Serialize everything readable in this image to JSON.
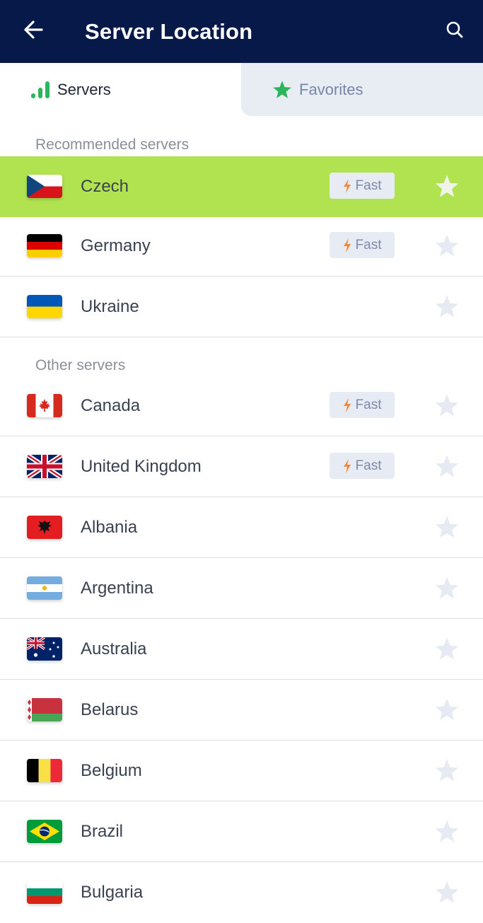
{
  "header": {
    "title": "Server Location",
    "background": "#061949",
    "back_icon": "arrow-left-icon",
    "search_icon": "search-icon"
  },
  "tabs": [
    {
      "label": "Servers",
      "icon": "signal-bars-icon",
      "active": true
    },
    {
      "label": "Favorites",
      "icon": "star-icon",
      "active": false
    }
  ],
  "colors": {
    "selected_row": "#b1e250",
    "signal_green": "#2bb65c",
    "favorites_star": "#2bb65c",
    "fast_bolt": "#f08a3c"
  },
  "sections": [
    {
      "title": "Recommended servers",
      "servers": [
        {
          "country": "Czech",
          "flag": "cz",
          "fast": true,
          "selected": true
        },
        {
          "country": "Germany",
          "flag": "de",
          "fast": true,
          "selected": false
        },
        {
          "country": "Ukraine",
          "flag": "ua",
          "fast": false,
          "selected": false
        }
      ]
    },
    {
      "title": "Other servers",
      "servers": [
        {
          "country": "Canada",
          "flag": "ca",
          "fast": true
        },
        {
          "country": "United Kingdom",
          "flag": "gb",
          "fast": true
        },
        {
          "country": "Albania",
          "flag": "al",
          "fast": false
        },
        {
          "country": "Argentina",
          "flag": "ar",
          "fast": false
        },
        {
          "country": "Australia",
          "flag": "au",
          "fast": false
        },
        {
          "country": "Belarus",
          "flag": "by",
          "fast": false
        },
        {
          "country": "Belgium",
          "flag": "be",
          "fast": false
        },
        {
          "country": "Brazil",
          "flag": "br",
          "fast": false
        },
        {
          "country": "Bulgaria",
          "flag": "bg",
          "fast": false
        }
      ]
    }
  ],
  "badge_label": "Fast"
}
